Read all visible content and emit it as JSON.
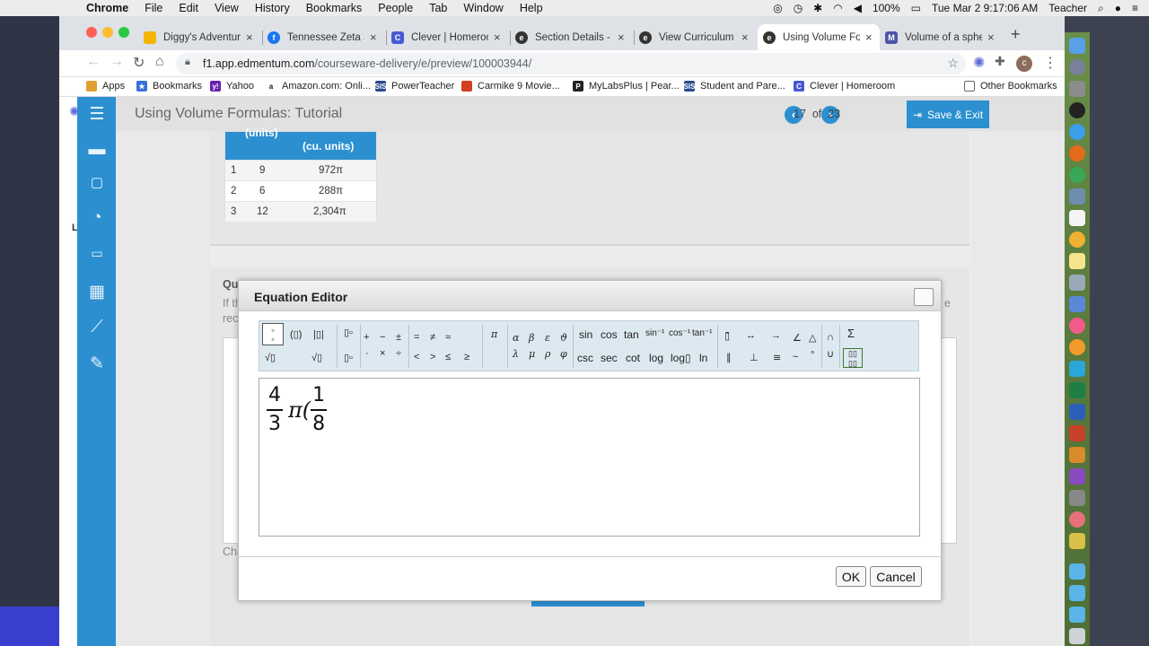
{
  "menubar": {
    "app": "Chrome",
    "items": [
      "File",
      "Edit",
      "View",
      "History",
      "Bookmarks",
      "People",
      "Tab",
      "Window",
      "Help"
    ],
    "battery": "100%",
    "datetime": "Tue Mar 2  9:17:06 AM",
    "user": "Teacher"
  },
  "tabs": [
    {
      "title": "Diggy's Adventure",
      "icon_color": "#f5b400"
    },
    {
      "title": "Tennessee Zeta Sh",
      "icon_color": "#1877f2"
    },
    {
      "title": "Clever | Homeroom",
      "icon_color": "#4659d4"
    },
    {
      "title": "Section Details - S",
      "icon_color": "#333333"
    },
    {
      "title": "View Curriculum",
      "icon_color": "#333333"
    },
    {
      "title": "Using Volume Form",
      "icon_color": "#333333"
    },
    {
      "title": "Volume of a sphere",
      "icon_color": "#4a55a8"
    }
  ],
  "url": {
    "domain": "f1.app.edmentum.com",
    "path": "/courseware-delivery/e/preview/100003944/"
  },
  "bookmarks": [
    "Apps",
    "Bookmarks",
    "Yahoo",
    "Amazon.com: Onli...",
    "PowerTeacher",
    "Carmike 9 Movie...",
    "MyLabsPlus | Pear...",
    "Student and Pare...",
    "Clever | Homeroom",
    "Other Bookmarks"
  ],
  "lesson": {
    "title": "Using Volume Formulas: Tutorial",
    "current": "17",
    "of_label": "of",
    "total": "23",
    "save_label": "Save & Exit"
  },
  "table": {
    "header_left": "(units)",
    "header_right": "(cu. units)",
    "rows": [
      {
        "n": "1",
        "r": "9",
        "v": "972π"
      },
      {
        "n": "2",
        "r": "6",
        "v": "288π"
      },
      {
        "n": "3",
        "r": "12",
        "v": "2,304π"
      }
    ]
  },
  "background_text": {
    "qu": "Qu",
    "if_th": "If th",
    "rec": "rec",
    "cha": "Cha",
    "e_trail": "e"
  },
  "modal": {
    "title": "Equation Editor",
    "palette": {
      "ops1": [
        "+",
        "−",
        "±",
        "·",
        "×",
        "÷"
      ],
      "rel": [
        "=",
        "≠",
        "≈",
        "<",
        ">",
        "≤",
        "≥"
      ],
      "pi": "π",
      "greek": [
        "α",
        "β",
        "ε",
        "ϑ",
        "λ",
        "μ",
        "ρ",
        "φ"
      ],
      "trig_row1": [
        "sin",
        "cos",
        "tan",
        "sin⁻¹",
        "cos⁻¹",
        "tan⁻¹"
      ],
      "trig_row2": [
        "csc",
        "sec",
        "cot",
        "log",
        "log▯",
        "ln"
      ],
      "geo_row1": [
        "▯̄",
        "↔",
        "→",
        "∠",
        "△"
      ],
      "geo_row2": [
        "∥",
        "⊥",
        "≅",
        "~",
        "°"
      ],
      "sets": [
        "∩",
        "∪"
      ],
      "sum": "Σ"
    },
    "expression": {
      "num1": "4",
      "den1": "3",
      "pi": "π(",
      "num2": "1",
      "den2": "8"
    },
    "ok_label": "OK",
    "cancel_label": "Cancel"
  },
  "colors": {
    "accent": "#2b8fd0",
    "palette_bg": "#dde9f0"
  }
}
